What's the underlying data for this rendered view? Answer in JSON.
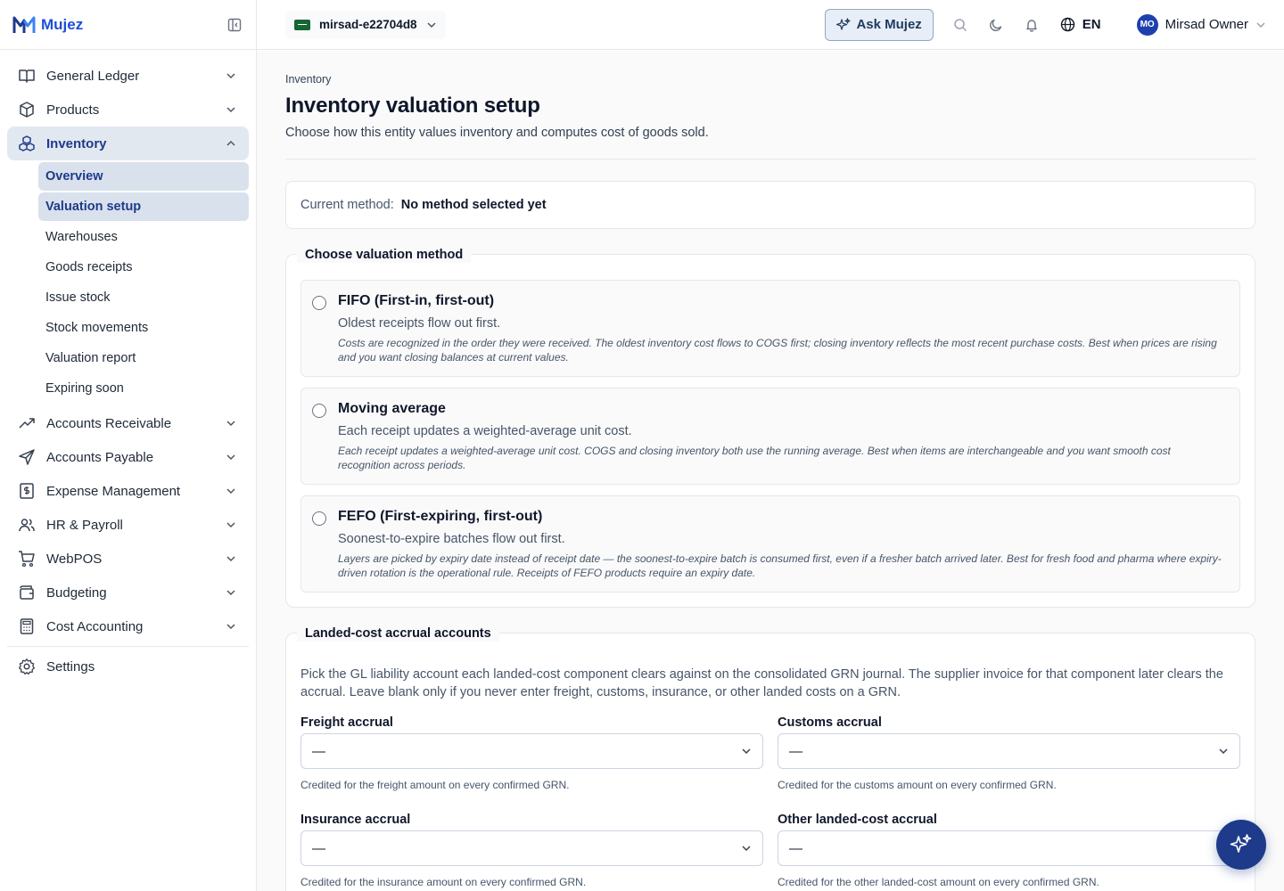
{
  "brand": {
    "name": "Mujez"
  },
  "sidebar": {
    "items": [
      {
        "label": "General Ledger",
        "icon": "book-icon"
      },
      {
        "label": "Products",
        "icon": "box-icon"
      },
      {
        "label": "Inventory",
        "icon": "boxes-icon",
        "expanded": true
      },
      {
        "label": "Accounts Receivable",
        "icon": "trending-up-icon"
      },
      {
        "label": "Accounts Payable",
        "icon": "send-icon"
      },
      {
        "label": "Expense Management",
        "icon": "receipt-icon"
      },
      {
        "label": "HR & Payroll",
        "icon": "users-icon"
      },
      {
        "label": "WebPOS",
        "icon": "cart-icon"
      },
      {
        "label": "Budgeting",
        "icon": "wallet-icon"
      },
      {
        "label": "Cost Accounting",
        "icon": "calculator-icon"
      }
    ],
    "inventory_sub": [
      "Overview",
      "Valuation setup",
      "Warehouses",
      "Goods receipts",
      "Issue stock",
      "Stock movements",
      "Valuation report",
      "Expiring soon"
    ],
    "settings": "Settings"
  },
  "topbar": {
    "entity": "mirsad-e22704d8",
    "ask": "Ask Mujez",
    "lang": "EN",
    "avatar_initials": "MO",
    "user_name": "Mirsad Owner"
  },
  "page": {
    "breadcrumb": "Inventory",
    "title": "Inventory valuation setup",
    "subtitle": "Choose how this entity values inventory and computes cost of goods sold.",
    "current_label": "Current method:",
    "current_value": "No method selected yet"
  },
  "valuation": {
    "legend": "Choose valuation method",
    "options": [
      {
        "title": "FIFO (First-in, first-out)",
        "short": "Oldest receipts flow out first.",
        "long": "Costs are recognized in the order they were received. The oldest inventory cost flows to COGS first; closing inventory reflects the most recent purchase costs. Best when prices are rising and you want closing balances at current values."
      },
      {
        "title": "Moving average",
        "short": "Each receipt updates a weighted-average unit cost.",
        "long": "Each receipt updates a weighted-average unit cost. COGS and closing inventory both use the running average. Best when items are interchangeable and you want smooth cost recognition across periods."
      },
      {
        "title": "FEFO (First-expiring, first-out)",
        "short": "Soonest-to-expire batches flow out first.",
        "long": "Layers are picked by expiry date instead of receipt date — the soonest-to-expire batch is consumed first, even if a fresher batch arrived later. Best for fresh food and pharma where expiry-driven rotation is the operational rule. Receipts of FEFO products require an expiry date."
      }
    ]
  },
  "accruals": {
    "legend": "Landed-cost accrual accounts",
    "description": "Pick the GL liability account each landed-cost component clears against on the consolidated GRN journal. The supplier invoice for that component later clears the accrual. Leave blank only if you never enter freight, customs, insurance, or other landed costs on a GRN.",
    "fields": [
      {
        "label": "Freight accrual",
        "value": "—",
        "help": "Credited for the freight amount on every confirmed GRN."
      },
      {
        "label": "Customs accrual",
        "value": "—",
        "help": "Credited for the customs amount on every confirmed GRN."
      },
      {
        "label": "Insurance accrual",
        "value": "—",
        "help": "Credited for the insurance amount on every confirmed GRN."
      },
      {
        "label": "Other landed-cost accrual",
        "value": "—",
        "help": "Credited for the other landed-cost amount on every confirmed GRN."
      }
    ]
  },
  "colors": {
    "accent": "#1e3a8a",
    "brand": "#1d4ed8",
    "active_bg": "#e2e8f0"
  }
}
